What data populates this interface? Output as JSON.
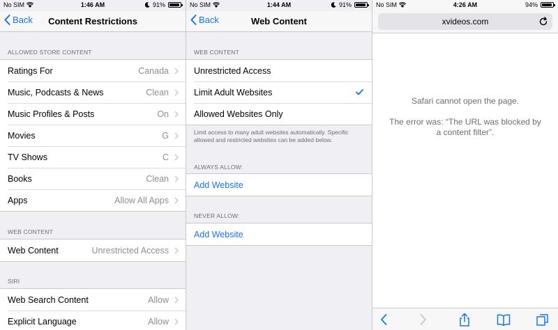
{
  "colors": {
    "accent": "#1a73e8",
    "separator": "#c8c7cc",
    "background": "#efeff4",
    "secondary_text": "#8e8e93"
  },
  "panel1": {
    "status": {
      "carrier": "No SIM",
      "time": "1:46 AM",
      "battery": "91%",
      "battery_level": 0.91
    },
    "nav": {
      "back_label": "Back",
      "title": "Content Restrictions"
    },
    "allowed_store": {
      "header": "ALLOWED STORE CONTENT",
      "rows": [
        {
          "label": "Ratings For",
          "value": "Canada"
        },
        {
          "label": "Music, Podcasts & News",
          "value": "Clean"
        },
        {
          "label": "Music Profiles & Posts",
          "value": "On"
        },
        {
          "label": "Movies",
          "value": "G"
        },
        {
          "label": "TV Shows",
          "value": "C"
        },
        {
          "label": "Books",
          "value": "Clean"
        },
        {
          "label": "Apps",
          "value": "Allow All Apps"
        }
      ]
    },
    "web_content": {
      "header": "WEB CONTENT",
      "rows": [
        {
          "label": "Web Content",
          "value": "Unrestricted Access"
        }
      ]
    },
    "siri": {
      "header": "SIRI",
      "rows": [
        {
          "label": "Web Search Content",
          "value": "Allow"
        },
        {
          "label": "Explicit Language",
          "value": "Allow"
        }
      ]
    }
  },
  "panel2": {
    "status": {
      "carrier": "No SIM",
      "time": "1:44 AM",
      "battery": "91%",
      "battery_level": 0.91
    },
    "nav": {
      "back_label": "Back",
      "title": "Web Content"
    },
    "web_content": {
      "header": "WEB CONTENT",
      "options": [
        {
          "label": "Unrestricted Access",
          "selected": false
        },
        {
          "label": "Limit Adult Websites",
          "selected": true
        },
        {
          "label": "Allowed Websites Only",
          "selected": false
        }
      ],
      "footer": "Limit access to many adult websites automatically. Specific allowed and restricted websites can be added below."
    },
    "always_allow": {
      "header": "ALWAYS ALLOW:",
      "add_label": "Add Website"
    },
    "never_allow": {
      "header": "NEVER ALLOW:",
      "add_label": "Add Website"
    }
  },
  "panel3": {
    "status": {
      "carrier": "No SIM",
      "time": "4:26 AM",
      "battery": "94%",
      "battery_level": 0.94
    },
    "url": "xvideos.com",
    "error_title": "Safari cannot open the page.",
    "error_detail": "The error was: “The URL was blocked by a content filter”.",
    "toolbar_icons": [
      "back-arrow-icon",
      "forward-arrow-icon",
      "share-icon",
      "bookmarks-icon",
      "tabs-icon"
    ]
  }
}
